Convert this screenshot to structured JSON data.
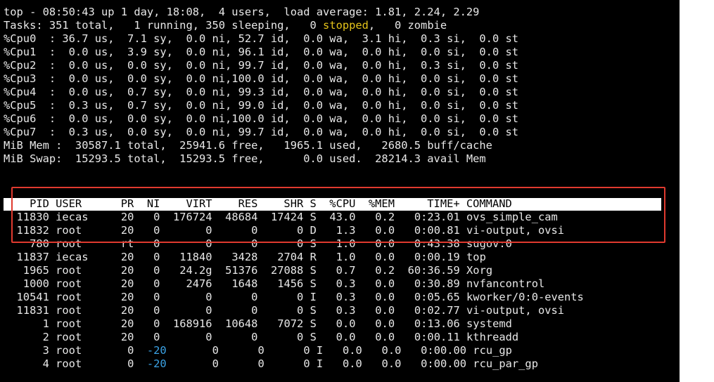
{
  "summary": {
    "top_line": "top - 08:50:43 up 1 day, 18:08,  4 users,  load average: 1.81, 2.24, 2.29",
    "tasks_prefix": "Tasks: 351 total,   1 running, 350 sleeping,   0 ",
    "tasks_stopped": "stopped",
    "tasks_suffix": ",   0 zombie",
    "cpu_lines": [
      "%Cpu0  : 36.7 us,  7.1 sy,  0.0 ni, 52.7 id,  0.0 wa,  3.1 hi,  0.3 si,  0.0 st",
      "%Cpu1  :  0.0 us,  3.9 sy,  0.0 ni, 96.1 id,  0.0 wa,  0.0 hi,  0.0 si,  0.0 st",
      "%Cpu2  :  0.0 us,  0.0 sy,  0.0 ni, 99.7 id,  0.0 wa,  0.0 hi,  0.3 si,  0.0 st",
      "%Cpu3  :  0.0 us,  0.0 sy,  0.0 ni,100.0 id,  0.0 wa,  0.0 hi,  0.0 si,  0.0 st",
      "%Cpu4  :  0.0 us,  0.7 sy,  0.0 ni, 99.3 id,  0.0 wa,  0.0 hi,  0.0 si,  0.0 st",
      "%Cpu5  :  0.3 us,  0.7 sy,  0.0 ni, 99.0 id,  0.0 wa,  0.0 hi,  0.0 si,  0.0 st",
      "%Cpu6  :  0.0 us,  0.0 sy,  0.0 ni,100.0 id,  0.0 wa,  0.0 hi,  0.0 si,  0.0 st",
      "%Cpu7  :  0.3 us,  0.0 sy,  0.0 ni, 99.7 id,  0.0 wa,  0.0 hi,  0.0 si,  0.0 st"
    ],
    "mem_line": "MiB Mem :  30587.1 total,  25941.6 free,   1965.1 used,   2680.5 buff/cache",
    "swap_line": "MiB Swap:  15293.5 total,  15293.5 free,      0.0 used.  28214.3 avail Mem"
  },
  "process_table": {
    "header": "    PID USER      PR  NI    VIRT    RES    SHR S  %CPU  %MEM     TIME+ COMMAND",
    "rows": [
      {
        "pid": "11830",
        "user": "iecas",
        "pr": "20",
        "ni": "0",
        "virt": "176724",
        "res": "48684",
        "shr": "17424",
        "s": "S",
        "cpu": "43.0",
        "mem": "0.2",
        "time": "0:23.01",
        "command": "ovs_simple_cam"
      },
      {
        "pid": "11832",
        "user": "root",
        "pr": "20",
        "ni": "0",
        "virt": "0",
        "res": "0",
        "shr": "0",
        "s": "D",
        "cpu": "1.3",
        "mem": "0.0",
        "time": "0:00.81",
        "command": "vi-output, ovsi"
      },
      {
        "pid": "780",
        "user": "root",
        "pr": "rt",
        "ni": "0",
        "virt": "0",
        "res": "0",
        "shr": "0",
        "s": "S",
        "cpu": "1.0",
        "mem": "0.0",
        "time": "0:43.38",
        "command": "sugov:0"
      },
      {
        "pid": "11837",
        "user": "iecas",
        "pr": "20",
        "ni": "0",
        "virt": "11840",
        "res": "3428",
        "shr": "2704",
        "s": "R",
        "cpu": "1.0",
        "mem": "0.0",
        "time": "0:00.19",
        "command": "top"
      },
      {
        "pid": "1965",
        "user": "root",
        "pr": "20",
        "ni": "0",
        "virt": "24.2g",
        "res": "51376",
        "shr": "27088",
        "s": "S",
        "cpu": "0.7",
        "mem": "0.2",
        "time": "60:36.59",
        "command": "Xorg"
      },
      {
        "pid": "1000",
        "user": "root",
        "pr": "20",
        "ni": "0",
        "virt": "2476",
        "res": "1648",
        "shr": "1456",
        "s": "S",
        "cpu": "0.3",
        "mem": "0.0",
        "time": "0:30.89",
        "command": "nvfancontrol"
      },
      {
        "pid": "10541",
        "user": "root",
        "pr": "20",
        "ni": "0",
        "virt": "0",
        "res": "0",
        "shr": "0",
        "s": "I",
        "cpu": "0.3",
        "mem": "0.0",
        "time": "0:05.65",
        "command": "kworker/0:0-events"
      },
      {
        "pid": "11831",
        "user": "root",
        "pr": "20",
        "ni": "0",
        "virt": "0",
        "res": "0",
        "shr": "0",
        "s": "S",
        "cpu": "0.3",
        "mem": "0.0",
        "time": "0:02.77",
        "command": "vi-output, ovsi"
      },
      {
        "pid": "1",
        "user": "root",
        "pr": "20",
        "ni": "0",
        "virt": "168916",
        "res": "10648",
        "shr": "7072",
        "s": "S",
        "cpu": "0.0",
        "mem": "0.0",
        "time": "0:13.06",
        "command": "systemd"
      },
      {
        "pid": "2",
        "user": "root",
        "pr": "20",
        "ni": "0",
        "virt": "0",
        "res": "0",
        "shr": "0",
        "s": "S",
        "cpu": "0.0",
        "mem": "0.0",
        "time": "0:00.11",
        "command": "kthreadd"
      },
      {
        "pid": "3",
        "user": "root",
        "pr": "0",
        "ni": "-20",
        "virt": "0",
        "res": "0",
        "shr": "0",
        "s": "I",
        "cpu": "0.0",
        "mem": "0.0",
        "time": "0:00.00",
        "command": "rcu_gp"
      },
      {
        "pid": "4",
        "user": "root",
        "pr": "0",
        "ni": "-20",
        "virt": "0",
        "res": "0",
        "shr": "0",
        "s": "I",
        "cpu": "0.0",
        "mem": "0.0",
        "time": "0:00.00",
        "command": "rcu_par_gp"
      }
    ]
  },
  "colors": {
    "background": "#000000",
    "foreground": "#e8e8e8",
    "header_bg": "#ffffff",
    "stopped": "#e5c41a",
    "negative_nice": "#3ba3e6",
    "annotation_box": "#e03a2f"
  }
}
